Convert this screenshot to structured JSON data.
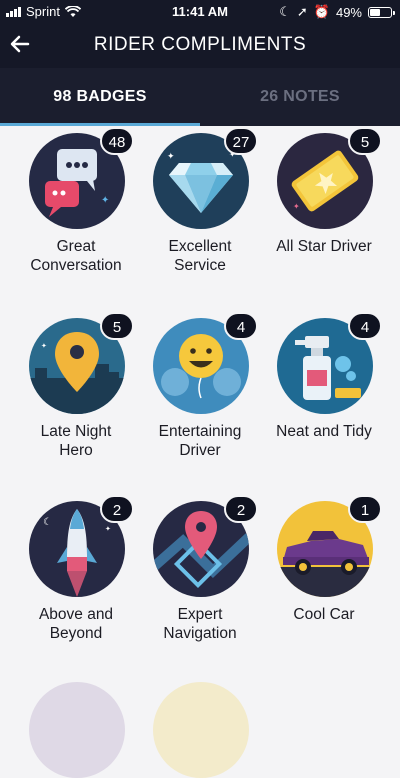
{
  "status": {
    "carrier": "Sprint",
    "time": "11:41 AM",
    "battery": "49%",
    "battery_level": 0.49
  },
  "header": {
    "title": "RIDER COMPLIMENTS"
  },
  "tabs": [
    {
      "label": "98 BADGES",
      "active": true
    },
    {
      "label": "26 NOTES",
      "active": false
    }
  ],
  "badges": [
    {
      "count": "48",
      "label": "Great\nConversation",
      "icon": "chat-bubbles-icon"
    },
    {
      "count": "27",
      "label": "Excellent\nService",
      "icon": "diamond-icon"
    },
    {
      "count": "5",
      "label": "All Star Driver",
      "icon": "gold-ticket-icon"
    },
    {
      "count": "5",
      "label": "Late Night\nHero",
      "icon": "map-pin-night-icon"
    },
    {
      "count": "4",
      "label": "Entertaining\nDriver",
      "icon": "smiley-balloon-icon"
    },
    {
      "count": "4",
      "label": "Neat and Tidy",
      "icon": "spray-bottle-icon"
    },
    {
      "count": "2",
      "label": "Above and\nBeyond",
      "icon": "rocket-icon"
    },
    {
      "count": "2",
      "label": "Expert\nNavigation",
      "icon": "navigation-pin-icon"
    },
    {
      "count": "1",
      "label": "Cool Car",
      "icon": "car-icon"
    }
  ]
}
